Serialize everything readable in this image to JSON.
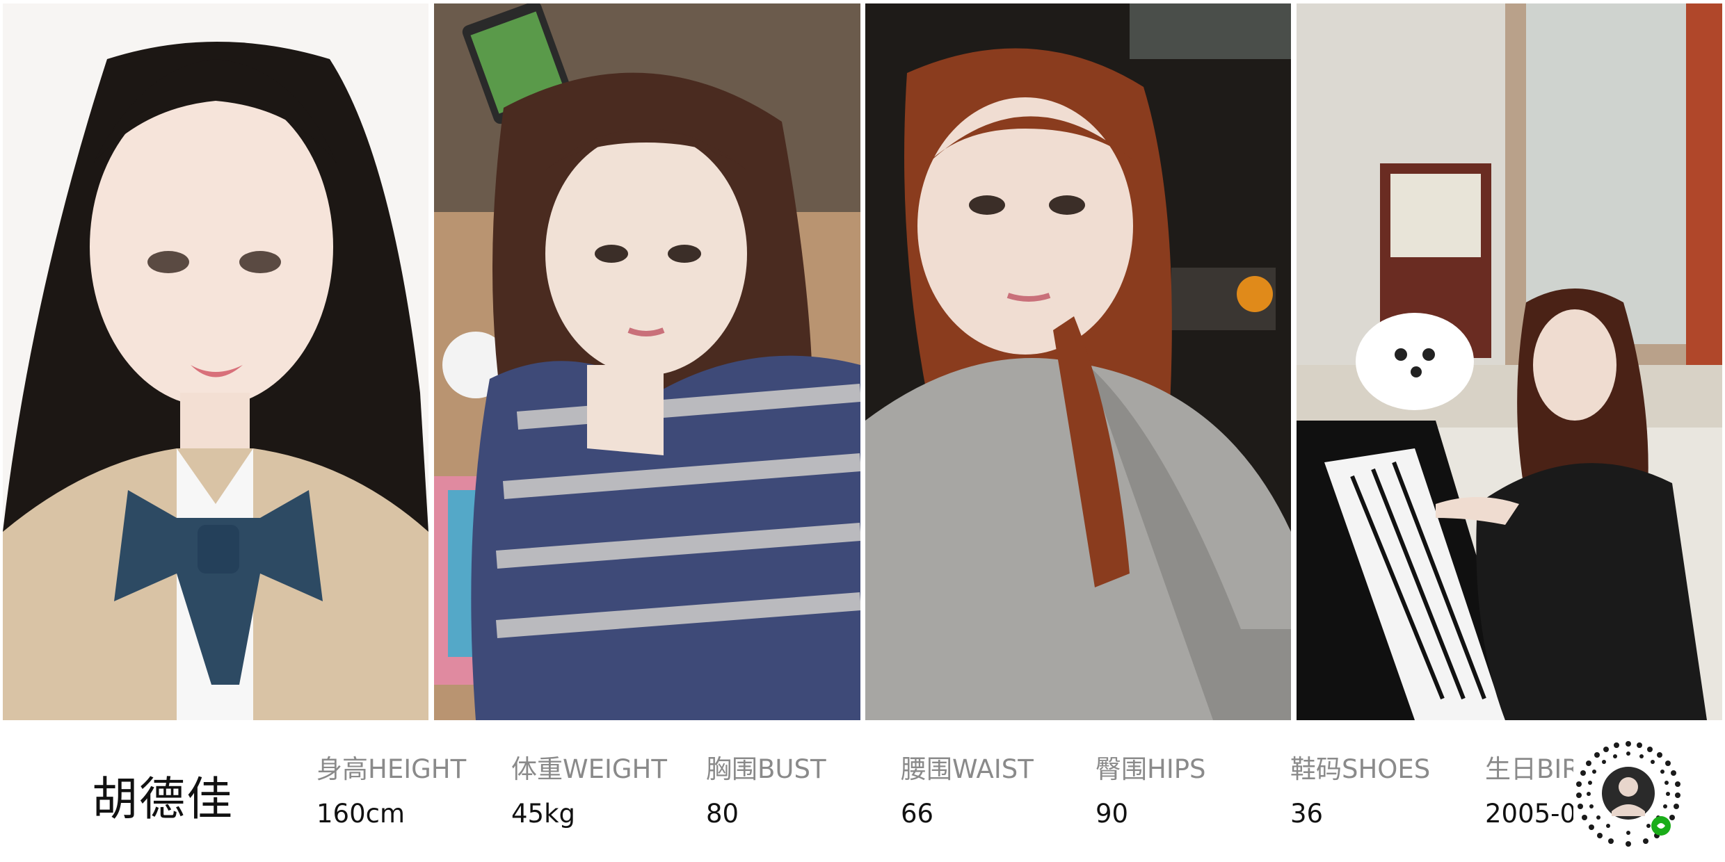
{
  "photos": [
    {
      "icon": "portrait-formal-photo"
    },
    {
      "icon": "selfie-plaid-hoodie-photo"
    },
    {
      "icon": "night-selfie-grey-hoodie-photo"
    },
    {
      "icon": "piano-playing-photo"
    }
  ],
  "profile": {
    "name": "胡德佳",
    "stats": [
      {
        "label": "身高HEIGHT",
        "value": "160cm"
      },
      {
        "label": "体重WEIGHT",
        "value": "45kg"
      },
      {
        "label": "胸围BUST",
        "value": "80"
      },
      {
        "label": "腰围WAIST",
        "value": "66"
      },
      {
        "label": "臀围HIPS",
        "value": "90"
      },
      {
        "label": "鞋码SHOES",
        "value": "36"
      },
      {
        "label": "生日BIR",
        "value": "2005-0"
      }
    ]
  },
  "qr": {
    "icon": "mini-program-qr-code-icon",
    "accent": "#1aad19"
  }
}
